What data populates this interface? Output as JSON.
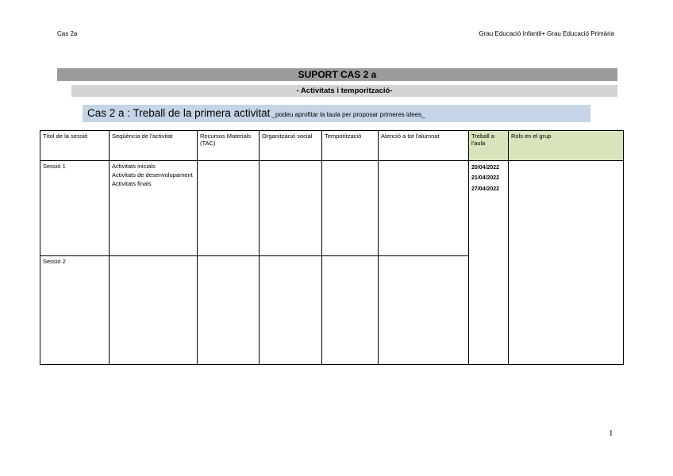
{
  "header": {
    "left": "Cas 2a",
    "right": "Grau Educació Infantil+ Grau Educació Primària"
  },
  "title": "SUPORT CAS 2 a",
  "subtitle": "-   Activitats i temporització-",
  "case_heading": {
    "main": "Cas 2 a : Treball de la primera activitat",
    "note": " _podeu aprofitar la taula per proposar primeres idees_"
  },
  "colors": {
    "title_bar": "#9b9b9b",
    "subtitle_bar": "#d4d4d4",
    "case_bar": "#c6d4e7",
    "rols_header": "#d8e4bc"
  },
  "table": {
    "headers": [
      "Títol de la sessió",
      "Seqüència de l'activitat",
      "Recursos Materials (TAC)",
      "Organització social",
      "Temporització",
      "Atenció a tot l'alumnat",
      "Treball a l'aula",
      "Rols en el grup"
    ],
    "sessions": [
      {
        "title": "Sessió 1",
        "activities": [
          "Activitats inicials",
          "Activitats de desenvolupament",
          "Activitats finals"
        ]
      },
      {
        "title": "Sessió 2",
        "activities": []
      }
    ],
    "dates": [
      "20/04/2022",
      "21/04/2022",
      "27/04/2022"
    ]
  },
  "page_number": "1"
}
